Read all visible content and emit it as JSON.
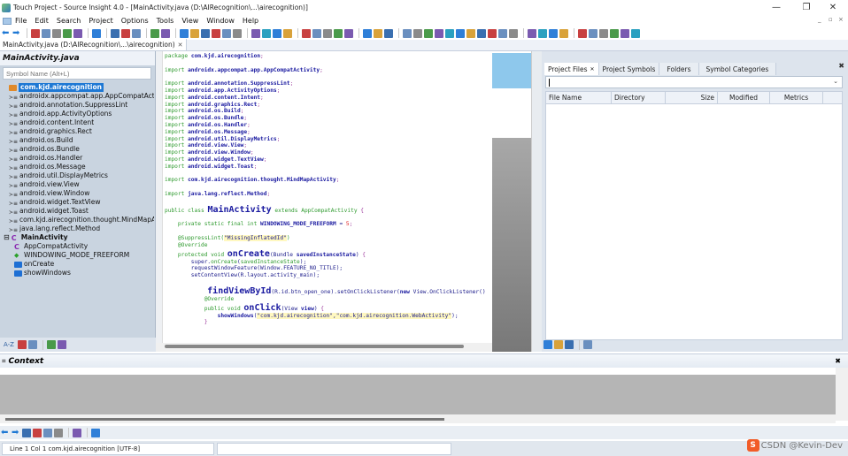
{
  "window": {
    "title": "Touch Project - Source Insight 4.0 - [MainActivity.java (D:\\AIRecognition\\...\\airecognition)]",
    "minimize": "—",
    "restore": "❐",
    "close": "✕"
  },
  "menu": {
    "items": [
      "File",
      "Edit",
      "Search",
      "Project",
      "Options",
      "Tools",
      "View",
      "Window",
      "Help"
    ],
    "mdi_controls": [
      "_",
      "▫",
      "×"
    ]
  },
  "toolbar": {
    "icons": [
      "back-arrow-icon",
      "forward-arrow-icon",
      "sep",
      "new-file-icon",
      "open-file-icon",
      "save-icon",
      "save-all-icon",
      "close-file-icon",
      "sep",
      "print-icon",
      "sep",
      "cut-icon",
      "copy-icon",
      "paste-icon",
      "sep",
      "undo-icon",
      "redo-icon",
      "sep",
      "lookup-references-icon",
      "jump-up-icon",
      "jump-down-icon",
      "browse-icon",
      "replace-icon",
      "search-files-icon",
      "sep",
      "bookmark-icon",
      "bookmark-list-icon",
      "window-icon",
      "fullscreen-icon",
      "sep",
      "project-icon",
      "symbol-icon",
      "books-icon",
      "relation-icon",
      "regex-icon",
      "sep",
      "layout1-icon",
      "layout2-icon",
      "layout3-icon",
      "sep",
      "sync-icon",
      "zoom-fit-icon",
      "tree-icon",
      "outline-icon",
      "context-icon",
      "clip-icon",
      "sibling-icon",
      "home-icon",
      "bird-icon",
      "merge-icon",
      "grid-icon",
      "sep",
      "indent-icon",
      "add-line-icon",
      "remove-line-icon",
      "delete-icon",
      "sep",
      "panel-a-icon",
      "panel-b-icon",
      "panel-c-icon",
      "panel-d-icon",
      "panel-e-icon",
      "panel-f-icon"
    ]
  },
  "tabs": [
    {
      "label": "MainActivity.java (D:\\AIRecognition\\...\\airecognition)",
      "close": "✕"
    }
  ],
  "symbol_panel": {
    "title": "MainActivity.java",
    "search_placeholder": "Symbol Name (Alt+L)",
    "tree": [
      {
        "label": "com.kjd.airecognition",
        "icon": "package-icon",
        "selected": true,
        "indent": 1
      },
      {
        "label": "androidx.appcompat.app.AppCompatActivity",
        "icon": "import-icon",
        "indent": 1
      },
      {
        "label": "android.annotation.SuppressLint",
        "icon": "import-icon",
        "indent": 1
      },
      {
        "label": "android.app.ActivityOptions",
        "icon": "import-icon",
        "indent": 1
      },
      {
        "label": "android.content.Intent",
        "icon": "import-icon",
        "indent": 1
      },
      {
        "label": "android.graphics.Rect",
        "icon": "import-icon",
        "indent": 1
      },
      {
        "label": "android.os.Build",
        "icon": "import-icon",
        "indent": 1
      },
      {
        "label": "android.os.Bundle",
        "icon": "import-icon",
        "indent": 1
      },
      {
        "label": "android.os.Handler",
        "icon": "import-icon",
        "indent": 1
      },
      {
        "label": "android.os.Message",
        "icon": "import-icon",
        "indent": 1
      },
      {
        "label": "android.util.DisplayMetrics",
        "icon": "import-icon",
        "indent": 1
      },
      {
        "label": "android.view.View",
        "icon": "import-icon",
        "indent": 1
      },
      {
        "label": "android.view.Window",
        "icon": "import-icon",
        "indent": 1
      },
      {
        "label": "android.widget.TextView",
        "icon": "import-icon",
        "indent": 1
      },
      {
        "label": "android.widget.Toast",
        "icon": "import-icon",
        "indent": 1
      },
      {
        "label": "com.kjd.airecognition.thought.MindMapActivity",
        "icon": "import-icon",
        "indent": 1
      },
      {
        "label": "java.lang.reflect.Method",
        "icon": "import-icon",
        "indent": 1
      },
      {
        "label": "MainActivity",
        "icon": "class-icon",
        "bold": true,
        "indent": 0,
        "expander": "⊟"
      },
      {
        "label": "AppCompatActivity",
        "icon": "class-icon",
        "indent": 2
      },
      {
        "label": "WINDOWING_MODE_FREEFORM",
        "icon": "constant-icon",
        "indent": 2
      },
      {
        "label": "onCreate",
        "icon": "method-icon",
        "indent": 2
      },
      {
        "label": "showWindows",
        "icon": "method-icon",
        "indent": 2
      }
    ],
    "bottom_icons": [
      "sort-az-icon",
      "list-view-icon",
      "category-icon",
      "sep",
      "book-icon",
      "settings-gear-icon"
    ],
    "sort_label": "A-Z"
  },
  "editor": {
    "lines": [
      [
        [
          "kw",
          "package "
        ],
        [
          "id",
          "com.kjd.airecognition"
        ],
        [
          "pun",
          ";"
        ]
      ],
      [],
      [
        [
          "kw",
          "import "
        ],
        [
          "id",
          "androidx.appcompat.app.AppCompatActivity"
        ],
        [
          "pun",
          ";"
        ]
      ],
      [],
      [
        [
          "kw",
          "import "
        ],
        [
          "id",
          "android.annotation.SuppressLint"
        ],
        [
          "pun",
          ";"
        ]
      ],
      [
        [
          "kw",
          "import "
        ],
        [
          "id",
          "android.app.ActivityOptions"
        ],
        [
          "pun",
          ";"
        ]
      ],
      [
        [
          "kw",
          "import "
        ],
        [
          "id",
          "android.content.Intent"
        ],
        [
          "pun",
          ";"
        ]
      ],
      [
        [
          "kw",
          "import "
        ],
        [
          "id",
          "android.graphics.Rect"
        ],
        [
          "pun",
          ";"
        ]
      ],
      [
        [
          "kw",
          "import "
        ],
        [
          "id",
          "android.os.Build"
        ],
        [
          "pun",
          ";"
        ]
      ],
      [
        [
          "kw",
          "import "
        ],
        [
          "id",
          "android.os.Bundle"
        ],
        [
          "pun",
          ";"
        ]
      ],
      [
        [
          "kw",
          "import "
        ],
        [
          "id",
          "android.os.Handler"
        ],
        [
          "pun",
          ";"
        ]
      ],
      [
        [
          "kw",
          "import "
        ],
        [
          "id",
          "android.os.Message"
        ],
        [
          "pun",
          ";"
        ]
      ],
      [
        [
          "kw",
          "import "
        ],
        [
          "id",
          "android.util.DisplayMetrics"
        ],
        [
          "pun",
          ";"
        ]
      ],
      [
        [
          "kw",
          "import "
        ],
        [
          "id",
          "android.view.View"
        ],
        [
          "pun",
          ";"
        ]
      ],
      [
        [
          "kw",
          "import "
        ],
        [
          "id",
          "android.view.Window"
        ],
        [
          "pun",
          ";"
        ]
      ],
      [
        [
          "kw",
          "import "
        ],
        [
          "id",
          "android.widget.TextView"
        ],
        [
          "pun",
          ";"
        ]
      ],
      [
        [
          "kw",
          "import "
        ],
        [
          "id",
          "android.widget.Toast"
        ],
        [
          "pun",
          ";"
        ]
      ],
      [],
      [
        [
          "kw",
          "import "
        ],
        [
          "id",
          "com.kjd.airecognition.thought.MindMapActivity"
        ],
        [
          "pun",
          ";"
        ]
      ],
      [],
      [
        [
          "kw",
          "import "
        ],
        [
          "id",
          "java.lang.reflect.Method"
        ],
        [
          "pun",
          ";"
        ]
      ],
      [],
      [
        [
          "kw",
          "public class "
        ],
        [
          "big",
          "MainActivity"
        ],
        [
          "kw",
          " extends AppCompatActivity "
        ],
        [
          "pun",
          "{"
        ]
      ],
      [],
      [
        [
          "kw",
          "    private static final int "
        ],
        [
          "id",
          "WINDOWING_MODE_FREEFORM"
        ],
        [
          "txt",
          " = "
        ],
        [
          "num",
          "5"
        ],
        [
          "pun",
          ";"
        ]
      ],
      [],
      [
        [
          "kw",
          "    @SuppressLint("
        ],
        [
          "str",
          "\"MissingInflatedId\""
        ],
        [
          "kw",
          ")"
        ]
      ],
      [
        [
          "kw",
          "    @Override"
        ]
      ],
      [
        [
          "kw",
          "    protected void "
        ],
        [
          "big",
          "onCreate"
        ],
        [
          "txt",
          "(Bundle "
        ],
        [
          "id",
          "savedInstanceState"
        ],
        [
          "txt",
          ") "
        ],
        [
          "pun",
          "{"
        ]
      ],
      [
        [
          "txt",
          "        super."
        ],
        [
          "kw",
          "onCreate"
        ],
        [
          "txt",
          "("
        ],
        [
          "kw",
          "savedInstanceState"
        ],
        [
          "txt",
          ");"
        ]
      ],
      [
        [
          "txt",
          "        requestWindowFeature(Window.FEATURE_NO_TITLE);"
        ]
      ],
      [
        [
          "txt",
          "        setContentView(R.layout.activity_main);"
        ]
      ],
      [],
      [
        [
          "big",
          "        findViewById"
        ],
        [
          "txt",
          "(R.id.btn_open_one).setOnClickListener("
        ],
        [
          "id",
          "new"
        ],
        [
          "txt",
          " View.OnClickListener() "
        ]
      ],
      [
        [
          "kw",
          "            @Override"
        ]
      ],
      [
        [
          "kw",
          "            public void "
        ],
        [
          "big",
          "onClick"
        ],
        [
          "txt",
          "(View "
        ],
        [
          "id",
          "view"
        ],
        [
          "txt",
          ") "
        ],
        [
          "pun",
          "{"
        ]
      ],
      [
        [
          "txt",
          "                "
        ],
        [
          "id",
          "showWindows"
        ],
        [
          "txt",
          "("
        ],
        [
          "str",
          "\"com.kjd.airecognition\",\"com.kjd.airecognition.WebActivity\""
        ],
        [
          "txt",
          ");"
        ]
      ],
      [
        [
          "pun",
          "            }"
        ]
      ]
    ]
  },
  "project_panel": {
    "tabs": [
      {
        "label": "Project Files",
        "close": "✕",
        "active": true
      },
      {
        "label": "Project Symbols"
      },
      {
        "label": "Folders"
      },
      {
        "label": "Symbol Categories"
      }
    ],
    "close": "✖",
    "filter_value": "",
    "columns": [
      "File Name",
      "Directory",
      "Size",
      "Modified",
      "Metrics"
    ],
    "rows": [],
    "bottom_icons": [
      "browse-files-icon",
      "sync-icon",
      "window-icon",
      "sep",
      "settings-gear-icon"
    ]
  },
  "context_panel": {
    "title": "Context",
    "close": "✖"
  },
  "bottom_toolbar": {
    "icons": [
      "back-arrow-icon",
      "forward-arrow-icon",
      "bookmark-icon",
      "books-icon",
      "regex-icon",
      "tree-icon",
      "sep",
      "lock-icon",
      "sep",
      "settings-gear-icon"
    ]
  },
  "status": {
    "text": "Line 1  Col 1   com.kjd.airecognition [UTF-8]"
  },
  "watermark": {
    "logo": "S",
    "text": "CSDN @Kevin-Dev"
  },
  "colors": {
    "selection": "#1e78d4",
    "keyword": "#2e9a2e",
    "identifier": "#1a1aa0",
    "panel_bg": "#c9d4e0"
  }
}
